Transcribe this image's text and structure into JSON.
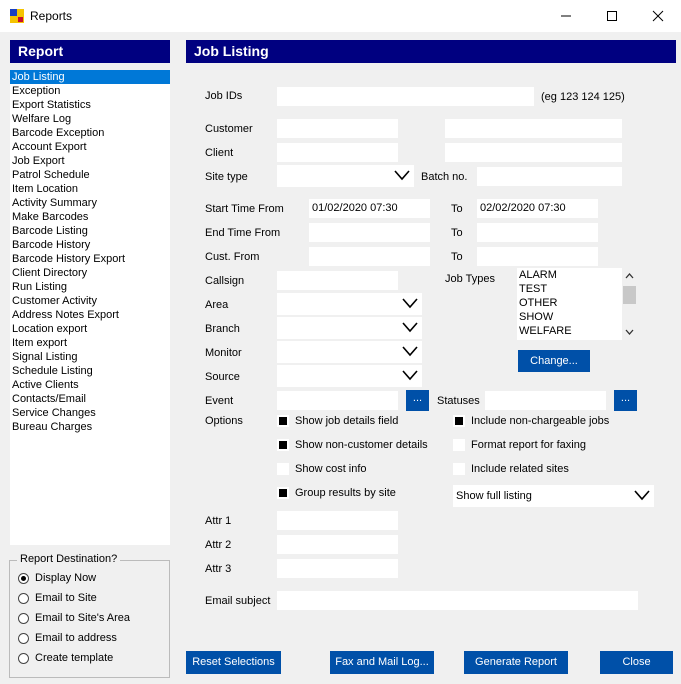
{
  "window": {
    "title": "Reports",
    "minimize": "—",
    "maximize": "☐",
    "close": "✕"
  },
  "sidebar": {
    "header": "Report",
    "items": [
      "Job Listing",
      "Exception",
      "Export Statistics",
      "Welfare Log",
      "Barcode Exception",
      "Account Export",
      "Job Export",
      "Patrol Schedule",
      "Item Location",
      "Activity Summary",
      "Make Barcodes",
      "Barcode Listing",
      "Barcode History",
      "Barcode History Export",
      "Client Directory",
      "Run Listing",
      "Customer Activity",
      "Address Notes Export",
      "Location export",
      "Item export",
      "Signal Listing",
      "Schedule Listing",
      "Active Clients",
      "Contacts/Email",
      "Service Changes",
      "Bureau Charges"
    ],
    "selected": "Job Listing"
  },
  "destination": {
    "title": "Report Destination?",
    "options": [
      "Display Now",
      "Email to Site",
      "Email to Site's Area",
      "Email to address",
      "Create template"
    ],
    "selected": "Display Now"
  },
  "main": {
    "header": "Job Listing",
    "job_ids_label": "Job IDs",
    "job_ids_hint": "(eg 123 124 125)",
    "customer_label": "Customer",
    "client_label": "Client",
    "site_type_label": "Site type",
    "batch_no_label": "Batch no.",
    "start_time_label": "Start Time From",
    "start_time_from": "01/02/2020 07:30",
    "to_label": "To",
    "start_time_to": "02/02/2020 07:30",
    "end_time_label": "End Time From",
    "cust_from_label": "Cust. From",
    "callsign_label": "Callsign",
    "area_label": "Area",
    "branch_label": "Branch",
    "monitor_label": "Monitor",
    "source_label": "Source",
    "event_label": "Event",
    "statuses_label": "Statuses",
    "ellipsis": "...",
    "job_types_label": "Job Types",
    "job_types": [
      "ALARM",
      "TEST",
      "OTHER",
      "SHOW",
      "WELFARE"
    ],
    "change_button": "Change...",
    "options_label": "Options",
    "options": {
      "show_job_details": "Show job details field",
      "show_non_customer": "Show non-customer details",
      "show_cost_info": "Show cost info",
      "group_by_site": "Group results by site",
      "include_non_chargeable": "Include non-chargeable jobs",
      "format_faxing": "Format report for faxing",
      "include_related": "Include related sites"
    },
    "listing_mode": "Show full listing",
    "attr1_label": "Attr 1",
    "attr2_label": "Attr 2",
    "attr3_label": "Attr 3",
    "email_subject_label": "Email subject"
  },
  "buttons": {
    "reset": "Reset Selections",
    "fax_mail": "Fax and Mail Log...",
    "generate": "Generate Report",
    "close": "Close"
  },
  "colors": {
    "header_bg": "#000080",
    "button_bg": "#0050a8",
    "selection": "#0078d7"
  }
}
